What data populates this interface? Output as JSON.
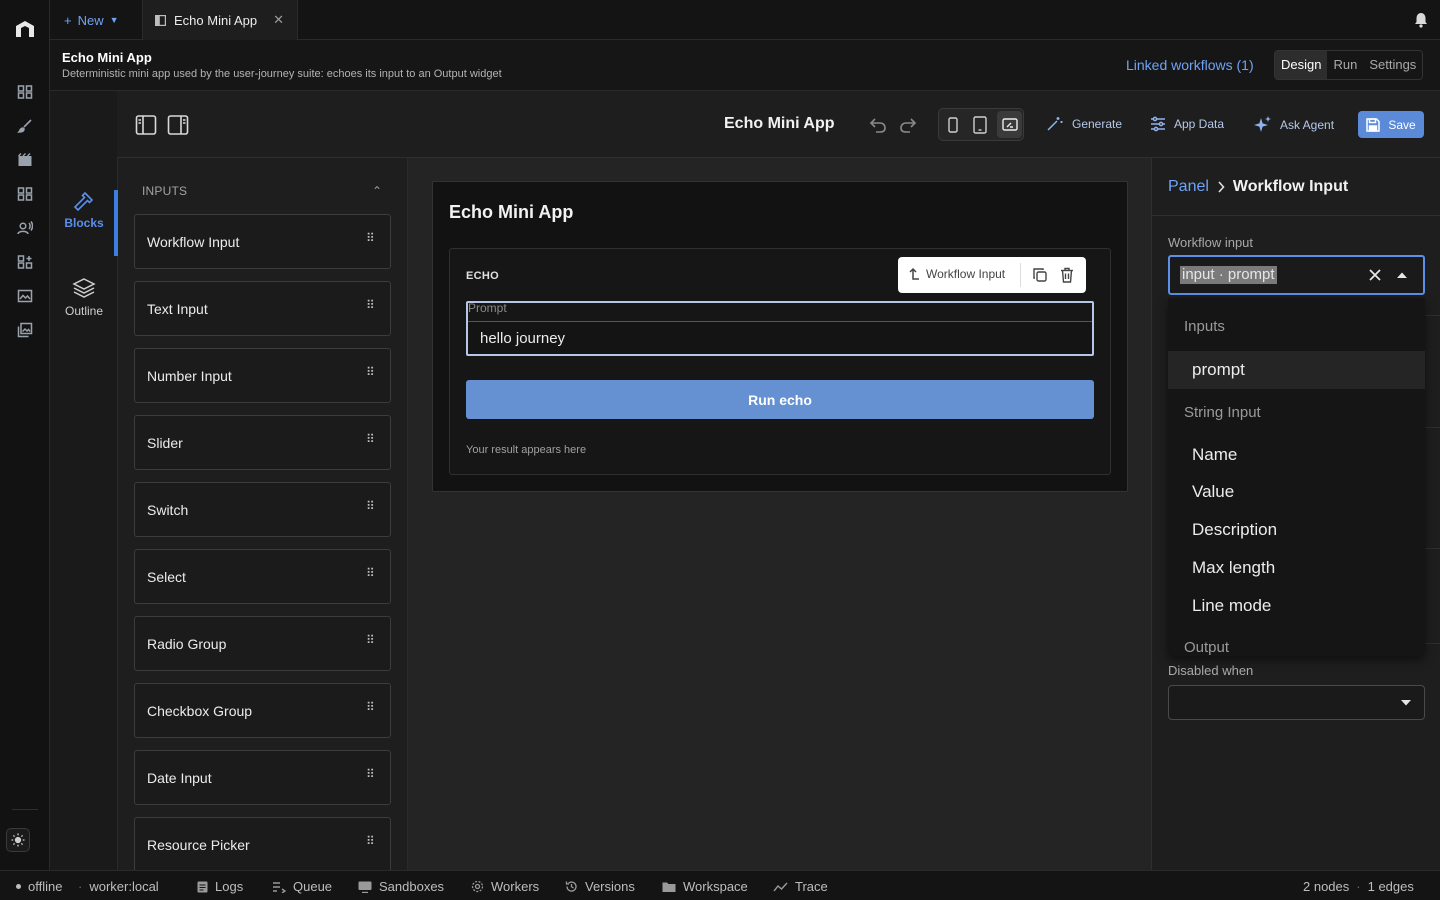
{
  "tabs": {
    "new_label": "New",
    "active_tab_label": "Echo Mini App"
  },
  "app": {
    "title": "Echo Mini App",
    "description": "Deterministic mini app used by the user-journey suite: echoes its input to an Output widget",
    "linked_workflows": "Linked workflows (1)",
    "modes": [
      "Design",
      "Run",
      "Settings"
    ],
    "active_mode": "Design"
  },
  "toolbar": {
    "title": "Echo Mini App",
    "generate": "Generate",
    "app_data": "App Data",
    "ask_agent": "Ask Agent",
    "save": "Save"
  },
  "sidebar": {
    "blocks_label": "Blocks",
    "outline_label": "Outline"
  },
  "palette": {
    "section": "INPUTS",
    "blocks": [
      "Workflow Input",
      "Text Input",
      "Number Input",
      "Slider",
      "Switch",
      "Select",
      "Radio Group",
      "Checkbox Group",
      "Date Input",
      "Resource Picker"
    ]
  },
  "canvas": {
    "app_title": "Echo Mini App",
    "panel_label": "ECHO",
    "selection_toolbar_label": "Workflow Input",
    "prompt_label": "Prompt",
    "prompt_value": "hello journey",
    "run_button": "Run echo",
    "result_placeholder": "Your result appears here"
  },
  "inspector": {
    "crumb_parent": "Panel",
    "crumb_current": "Workflow Input",
    "workflow_input_label": "Workflow input",
    "combo_value": "input · prompt",
    "dropdown": {
      "group_inputs": "Inputs",
      "inputs_items": [
        "prompt"
      ],
      "group_string": "String Input",
      "string_items": [
        "Name",
        "Value",
        "Description",
        "Max length",
        "Line mode"
      ],
      "group_output": "Output"
    },
    "disabled_when_label": "Disabled when"
  },
  "status": {
    "offline": "offline",
    "worker": "worker:local",
    "logs": "Logs",
    "queue": "Queue",
    "sandboxes": "Sandboxes",
    "workers": "Workers",
    "versions": "Versions",
    "workspace": "Workspace",
    "trace": "Trace",
    "nodes": "2 nodes",
    "edges": "1 edges"
  },
  "colors": {
    "accent": "#5b8fe8",
    "link": "#6fa3f5",
    "run_button": "#6590d1",
    "save_button": "#5b8ad9"
  }
}
